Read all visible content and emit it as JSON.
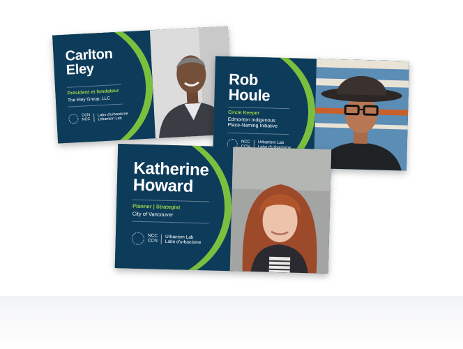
{
  "cards": {
    "carlton": {
      "name_line1": "Carlton",
      "name_line2": "Eley",
      "role": "Président et fondateur",
      "org": "The Eley Group, LLC",
      "logo_abbr_1": "CCN",
      "logo_abbr_2": "NCC",
      "logo_lab_1": "Labo d'urbanisme",
      "logo_lab_2": "Urbanism Lab"
    },
    "rob": {
      "name_line1": "Rob",
      "name_line2": "Houle",
      "role": "Circle Keeper",
      "org_line1": "Edmonton Indigenous",
      "org_line2": "Place-Naming Initiative",
      "logo_abbr_1": "NCC",
      "logo_abbr_2": "CCN",
      "logo_lab_1": "Urbanism Lab",
      "logo_lab_2": "Labo d'urbanisme"
    },
    "katherine": {
      "name_line1": "Katherine",
      "name_line2": "Howard",
      "role": "Planner | Strategist",
      "org": "City of Vancouver",
      "logo_abbr_1": "NCC",
      "logo_abbr_2": "CCN",
      "logo_lab_1": "Urbanism Lab",
      "logo_lab_2": "Labo d'urbanisme"
    }
  },
  "colors": {
    "card_navy": "#0d3b5a",
    "accent_green": "#7bbf3f",
    "role_green": "#9bd24a"
  }
}
